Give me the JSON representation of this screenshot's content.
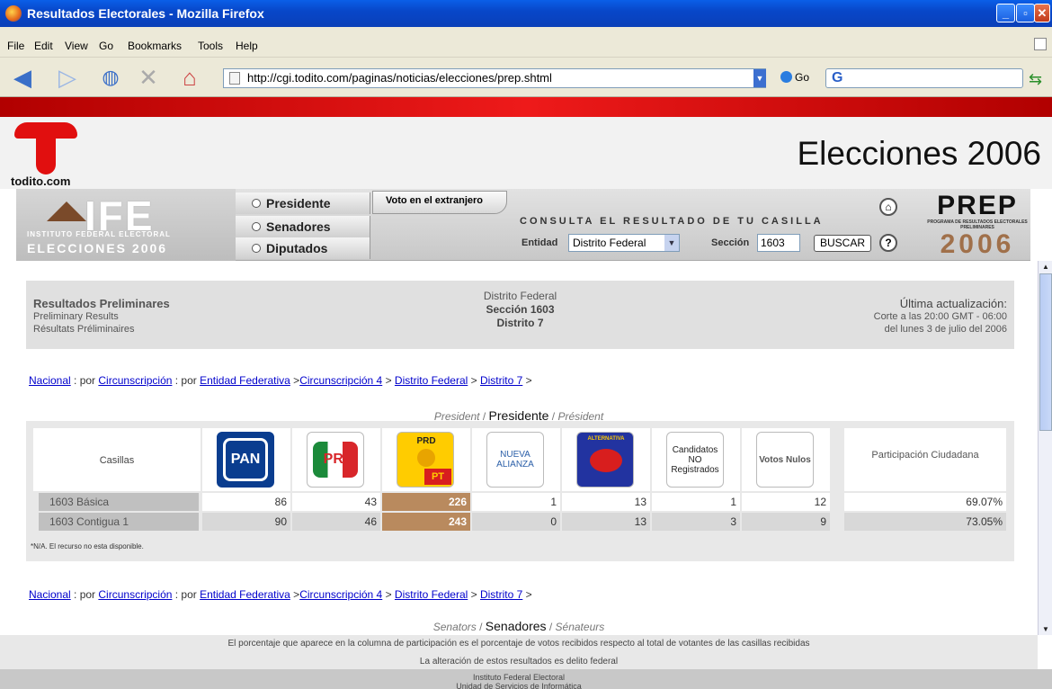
{
  "window": {
    "title": "Resultados Electorales - Mozilla Firefox"
  },
  "menu": [
    "File",
    "Edit",
    "View",
    "Go",
    "Bookmarks",
    "Tools",
    "Help"
  ],
  "nav": {
    "url": "http://cgi.todito.com/paginas/noticias/elecciones/prep.shtml",
    "go_label": "Go",
    "search_value": "G"
  },
  "header": {
    "logo_text": "todito.com",
    "title": "Elecciones 2006"
  },
  "ife": {
    "logo": "IFE",
    "logo_sub1": "INSTITUTO FEDERAL ELECTORAL",
    "logo_sub2": "ELECCIONES 2006",
    "nav": [
      "Presidente",
      "Senadores",
      "Diputados"
    ],
    "extranjero": "Voto en el extranjero",
    "consulta": "CONSULTA EL RESULTADO DE TU CASILLA",
    "entidad_label": "Entidad",
    "entidad_value": "Distrito Federal",
    "seccion_label": "Sección",
    "seccion_value": "1603",
    "buscar_label": "BUSCAR",
    "prep_1": "PREP",
    "prep_2": "PROGRAMA DE RESULTADOS ELECTORALES PRELIMINARES",
    "prep_3": "2006"
  },
  "info": {
    "left_1": "Resultados Preliminares",
    "left_2": "Preliminary Results",
    "left_3": "Résultats Préliminaires",
    "center_1": "Distrito Federal",
    "center_2": "Sección 1603",
    "center_3": "Distrito 7",
    "right_1": "Última actualización:",
    "right_2": "Corte a las 20:00 GMT - 06:00",
    "right_3": "del lunes 3 de julio del 2006"
  },
  "breadcrumb": {
    "nacional": "Nacional",
    "sep1": " : por ",
    "circ": "Circunscripción",
    "sep2": " : por ",
    "entidad": "Entidad Federativa",
    "sep3": " >",
    "circ4": "Circunscripción 4",
    "sep4": " > ",
    "df": "Distrito Federal",
    "sep5": " > ",
    "d7": "Distrito 7",
    "sep6": " >"
  },
  "presidente": {
    "en": "President",
    "es": "Presidente",
    "fr": "Président",
    "slash": " / "
  },
  "senadores": {
    "en": "Senators",
    "es": "Senadores",
    "fr": "Sénateurs",
    "slash": " / "
  },
  "table": {
    "casillas_header": "Casillas",
    "parties": [
      "PAN",
      "PRI",
      "PRD",
      "NUEVA ALIANZA",
      "ALTERNATIVA"
    ],
    "party_text": {
      "pan": "PAN",
      "pri": "PRI",
      "prd_top": "PRD",
      "pt": "PT",
      "na1": "NUEVA",
      "na2": "ALIANZA",
      "alt": "ALTERNATIVA"
    },
    "no_registrados": "Candidatos NO Registrados",
    "nulos": "Votos Nulos",
    "participacion": "Participación Ciudadana",
    "rows": [
      {
        "label": "1603 Básica",
        "values": [
          "86",
          "43",
          "226",
          "1",
          "13",
          "1",
          "12"
        ],
        "part": "69.07%"
      },
      {
        "label": "1603 Contigua 1",
        "values": [
          "90",
          "46",
          "243",
          "0",
          "13",
          "3",
          "9"
        ],
        "part": "73.05%"
      }
    ],
    "highlight_color": "#b98a5e"
  },
  "note": "*N/A. El recurso no esta disponible.",
  "footer": {
    "line1": "El porcentaje que aparece en la columna de participación es el porcentaje de votos recibidos respecto al total de votantes de las casillas recibidas",
    "line2": "La alteración de estos resultados es delito federal",
    "line3": "Instituto Federal Electoral",
    "line4": "Unidad de Servicios de Informática"
  }
}
